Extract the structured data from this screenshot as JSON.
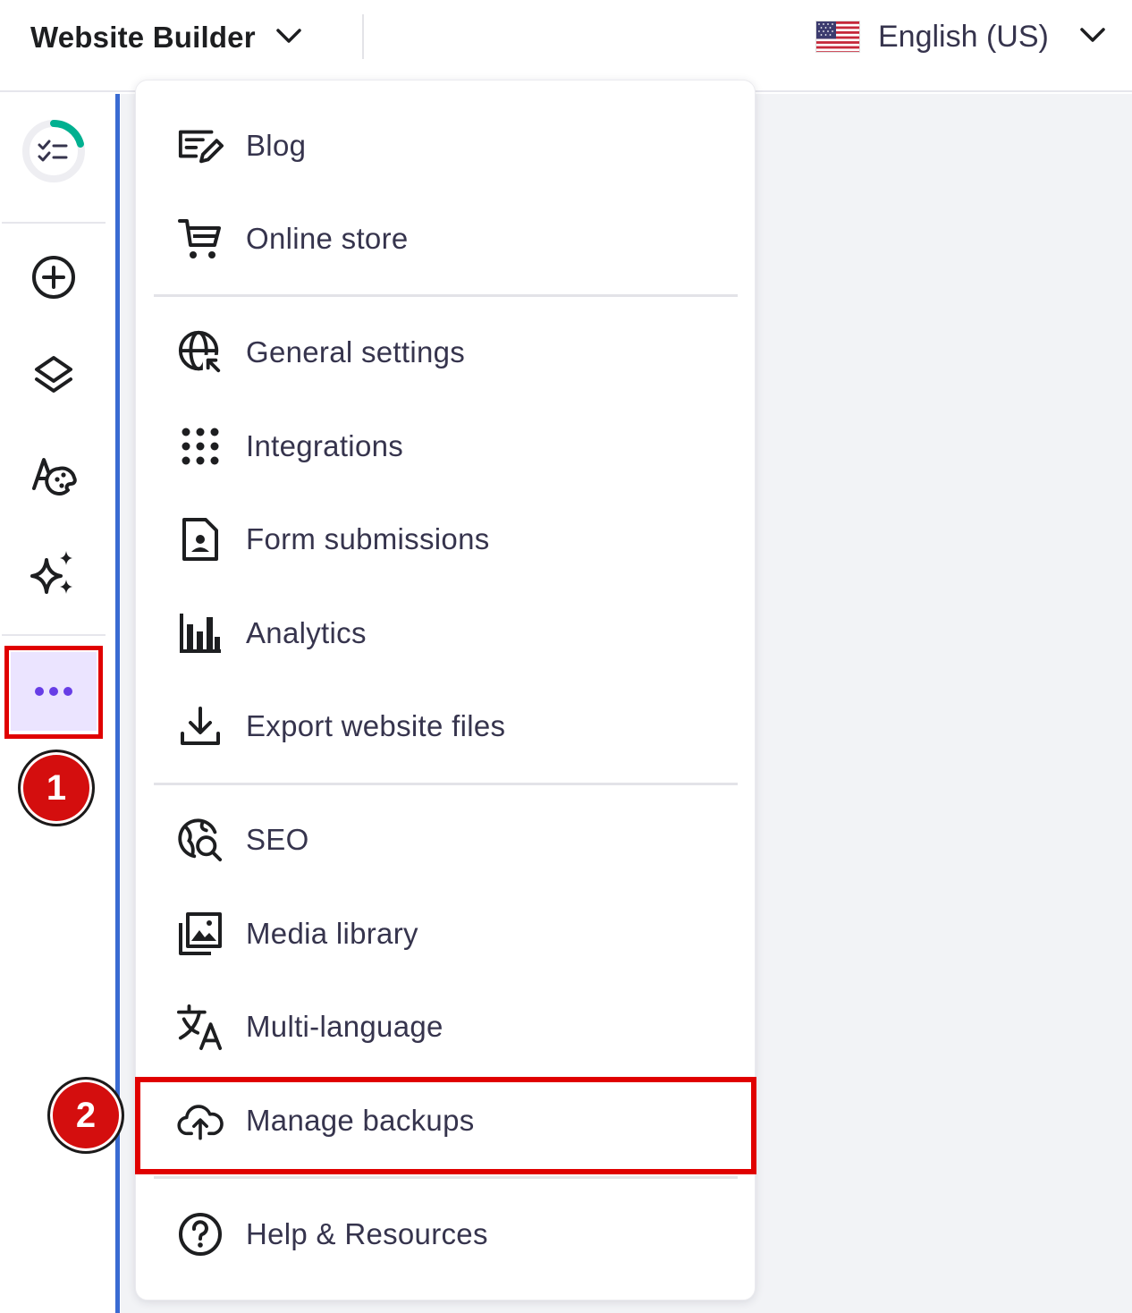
{
  "topbar": {
    "app_title": "Website Builder",
    "language_label": "English (US)",
    "language_flag": "us-flag-icon"
  },
  "sidebar": {
    "items": [
      {
        "name": "checklist-progress",
        "icon": "checklist-icon"
      },
      {
        "name": "add-element",
        "icon": "plus-circle-icon"
      },
      {
        "name": "pages-layers",
        "icon": "layers-icon"
      },
      {
        "name": "styles",
        "icon": "font-palette-icon"
      },
      {
        "name": "ai-tools",
        "icon": "sparkles-icon"
      },
      {
        "name": "more",
        "icon": "more-dots-icon"
      }
    ],
    "accent_color": "#673de6",
    "active_bg": "#ebe4ff"
  },
  "menu": {
    "items": [
      {
        "label": "Blog",
        "icon": "blog-icon"
      },
      {
        "label": "Online store",
        "icon": "cart-icon"
      },
      {
        "label": "General settings",
        "icon": "globe-settings-icon"
      },
      {
        "label": "Integrations",
        "icon": "grid-dots-icon"
      },
      {
        "label": "Form submissions",
        "icon": "form-document-icon"
      },
      {
        "label": "Analytics",
        "icon": "bar-chart-icon"
      },
      {
        "label": "Export website files",
        "icon": "download-icon"
      },
      {
        "label": "SEO",
        "icon": "seo-search-icon"
      },
      {
        "label": "Media library",
        "icon": "media-library-icon"
      },
      {
        "label": "Multi-language",
        "icon": "translate-icon"
      },
      {
        "label": "Manage backups",
        "icon": "cloud-upload-icon"
      },
      {
        "label": "Help & Resources",
        "icon": "help-icon"
      }
    ]
  },
  "annotations": {
    "step_1": "1",
    "step_2": "2",
    "highlight_color": "#e00000"
  }
}
